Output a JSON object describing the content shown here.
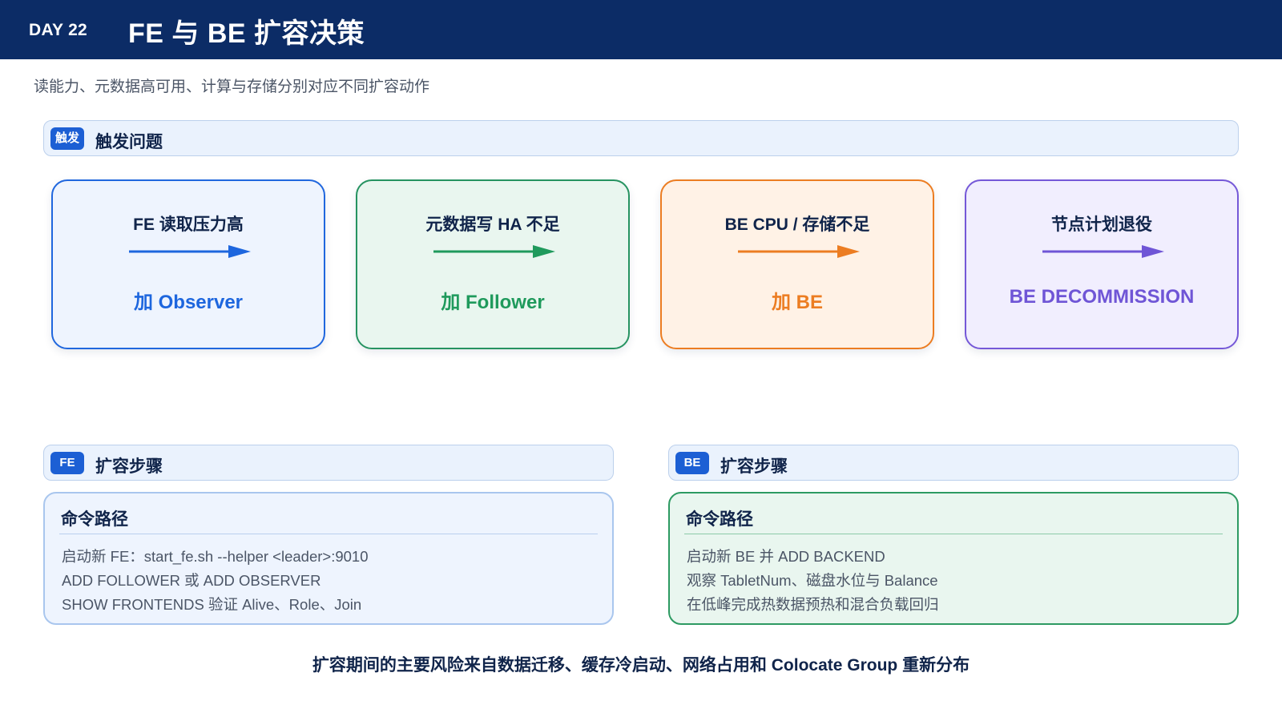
{
  "header": {
    "day": "DAY 22",
    "title": "FE 与 BE 扩容决策"
  },
  "subtitle": "读能力、元数据高可用、计算与存储分别对应不同扩容动作",
  "trigger_section": {
    "tag": "触发",
    "label": "触发问题"
  },
  "cards": [
    {
      "title": "FE 读取压力高",
      "action": "加 Observer",
      "color": "#1d66de"
    },
    {
      "title": "元数据写 HA 不足",
      "action": "加 Follower",
      "color": "#1f9a5c"
    },
    {
      "title": "BE CPU / 存储不足",
      "action": "加 BE",
      "color": "#ec7d22"
    },
    {
      "title": "节点计划退役",
      "action": "BE DECOMMISSION",
      "color": "#6f55d6"
    }
  ],
  "fe_section": {
    "tag": "FE",
    "label": "扩容步骤",
    "panel_title": "命令路径",
    "steps": [
      "启动新 FE：start_fe.sh --helper <leader>:9010",
      "ADD FOLLOWER 或 ADD OBSERVER",
      "SHOW FRONTENDS 验证 Alive、Role、Join"
    ]
  },
  "be_section": {
    "tag": "BE",
    "label": "扩容步骤",
    "panel_title": "命令路径",
    "steps": [
      "启动新 BE 并 ADD BACKEND",
      "观察 TabletNum、磁盘水位与 Balance",
      "在低峰完成热数据预热和混合负载回归"
    ]
  },
  "footer": "扩容期间的主要风险来自数据迁移、缓存冷启动、网络占用和 Colocate Group 重新分布"
}
